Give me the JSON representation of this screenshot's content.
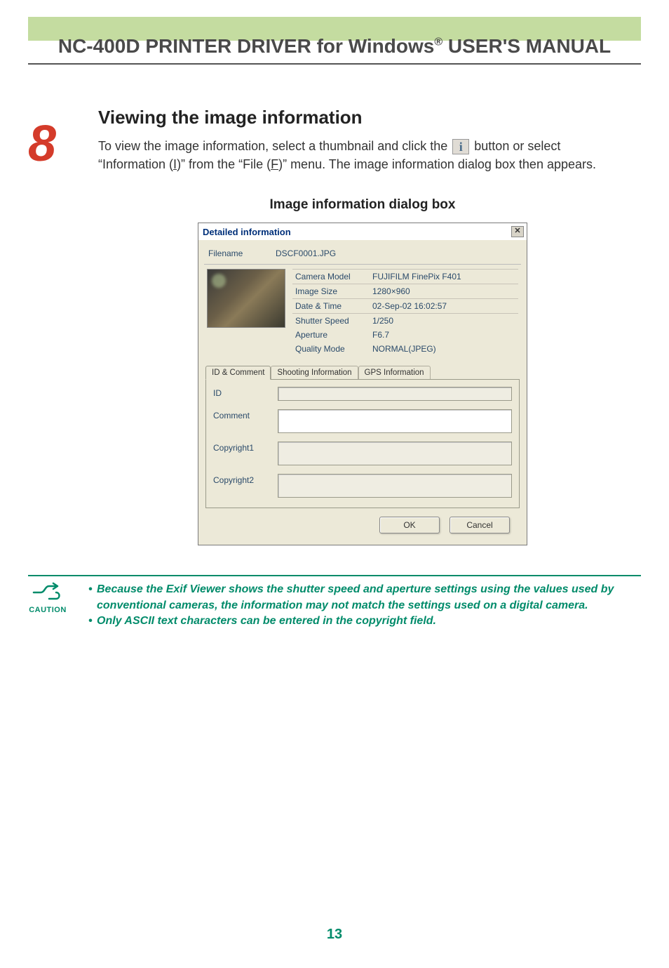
{
  "header": {
    "title_pre": "NC-400D PRINTER DRIVER for Windows",
    "title_post": " USER'S MANUAL"
  },
  "step_number": "8",
  "section": {
    "title": "Viewing the image information",
    "para_part1": "To view the image information, select a thumbnail and click the ",
    "para_part2": " button or select “Information (",
    "para_ul1": "I",
    "para_part3": ")” from the “File (",
    "para_ul2": "F",
    "para_part4": ")” menu. The image information dialog box then appears."
  },
  "dialog_caption": "Image information dialog box",
  "dialog": {
    "title": "Detailed information",
    "filename_label": "Filename",
    "filename_value": "DSCF0001.JPG",
    "rows": {
      "camera_model_label": "Camera Model",
      "camera_model_value": "FUJIFILM FinePix F401",
      "image_size_label": "Image Size",
      "image_size_value": "1280×960",
      "date_time_label": "Date & Time",
      "date_time_value": "02-Sep-02 16:02:57",
      "shutter_label": "Shutter Speed",
      "shutter_value": "1/250",
      "aperture_label": "Aperture",
      "aperture_value": "F6.7",
      "quality_label": "Quality Mode",
      "quality_value": "NORMAL(JPEG)"
    },
    "tabs": {
      "id_comment": "ID & Comment",
      "shooting": "Shooting Information",
      "gps": "GPS Information"
    },
    "fields": {
      "id_label": "ID",
      "id_value": "",
      "comment_label": "Comment",
      "comment_value": "",
      "copyright1_label": "Copyright1",
      "copyright1_value": "",
      "copyright2_label": "Copyright2",
      "copyright2_value": ""
    },
    "buttons": {
      "ok": "OK",
      "cancel": "Cancel"
    }
  },
  "caution": {
    "label": "CAUTION",
    "item1": "Because the Exif Viewer shows the shutter speed and aperture settings using the values used by conventional cameras, the information may not match the settings used on a digital camera.",
    "item2": "Only ASCII text characters can be entered in the copyright field."
  },
  "page_number": "13"
}
